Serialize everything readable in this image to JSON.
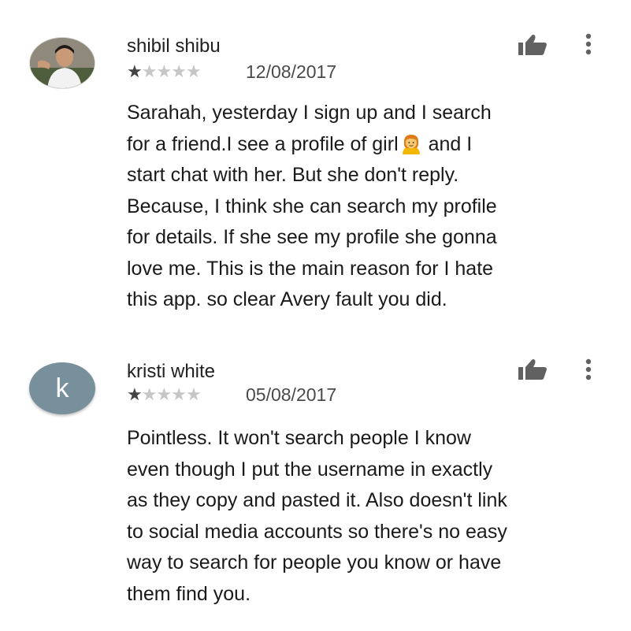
{
  "reviews": [
    {
      "avatar_type": "photo",
      "avatar_icon": "user-photo",
      "avatar_letter": "",
      "author": "shibil shibu",
      "rating": 1,
      "rating_max": 5,
      "date": "12/08/2017",
      "text_before_emoji": "Sarahah, yesterday I sign up and I search\nfor a friend.I see a profile of girl",
      "emoji": "girl-emoji",
      "text_after_emoji": "  and I\nstart chat with her. But she don't reply.\nBecause, I think she can search my profile\nfor details. If she see my profile she gonna\nlove me. This is the main reason for I hate\nthis app. so clear Avery fault you did."
    },
    {
      "avatar_type": "letter",
      "avatar_icon": "",
      "avatar_letter": "k",
      "author": "kristi white",
      "rating": 1,
      "rating_max": 5,
      "date": "05/08/2017",
      "text": "Pointless. It won't search people I know\neven though I put the username in exactly\nas they copy and pasted it. Also doesn't link\nto social media accounts so there's no easy\nway to search for people you know or have\nthem find you."
    }
  ],
  "icons": {
    "helpful": "thumbs-up-icon",
    "menu": "more-vert-icon",
    "star": "star-icon"
  },
  "colors": {
    "text": "#212121",
    "star_filled": "#424242",
    "star_empty": "#c6c6c6",
    "icon": "#616161",
    "avatar_letter_bg": "#78909c"
  }
}
